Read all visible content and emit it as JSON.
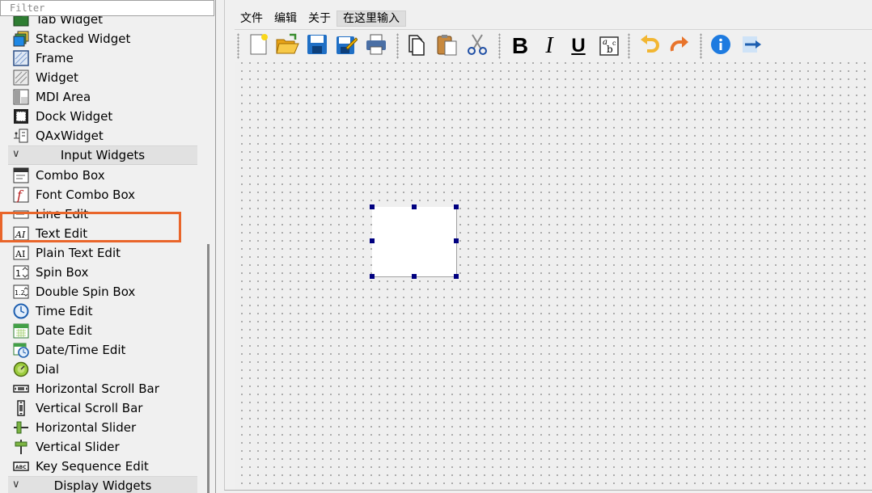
{
  "widget_box": {
    "filter_placeholder": "Filter",
    "section_top": [
      {
        "label": "Tab Widget",
        "icon": "tab-widget-icon"
      },
      {
        "label": "Stacked Widget",
        "icon": "stacked-widget-icon"
      },
      {
        "label": "Frame",
        "icon": "frame-icon"
      },
      {
        "label": "Widget",
        "icon": "widget-icon"
      },
      {
        "label": "MDI Area",
        "icon": "mdi-area-icon"
      },
      {
        "label": "Dock Widget",
        "icon": "dock-widget-icon"
      },
      {
        "label": "QAxWidget",
        "icon": "qaxwidget-icon"
      }
    ],
    "category_input": "Input Widgets",
    "input_widgets": [
      {
        "label": "Combo Box",
        "icon": "combo-box-icon"
      },
      {
        "label": "Font Combo Box",
        "icon": "font-combo-box-icon"
      },
      {
        "label": "Line Edit",
        "icon": "line-edit-icon"
      },
      {
        "label": "Text Edit",
        "icon": "text-edit-icon"
      },
      {
        "label": "Plain Text Edit",
        "icon": "plain-text-edit-icon"
      },
      {
        "label": "Spin Box",
        "icon": "spin-box-icon"
      },
      {
        "label": "Double Spin Box",
        "icon": "double-spin-box-icon"
      },
      {
        "label": "Time Edit",
        "icon": "time-edit-icon"
      },
      {
        "label": "Date Edit",
        "icon": "date-edit-icon"
      },
      {
        "label": "Date/Time Edit",
        "icon": "date-time-edit-icon"
      },
      {
        "label": "Dial",
        "icon": "dial-icon"
      },
      {
        "label": "Horizontal Scroll Bar",
        "icon": "horizontal-scroll-bar-icon"
      },
      {
        "label": "Vertical Scroll Bar",
        "icon": "vertical-scroll-bar-icon"
      },
      {
        "label": "Horizontal Slider",
        "icon": "horizontal-slider-icon"
      },
      {
        "label": "Vertical Slider",
        "icon": "vertical-slider-icon"
      },
      {
        "label": "Key Sequence Edit",
        "icon": "key-sequence-edit-icon"
      }
    ],
    "category_display": "Display Widgets",
    "highlighted_item": "Text Edit",
    "highlight_color": "#e9652a"
  },
  "form": {
    "menu": [
      "文件",
      "编辑",
      "关于",
      "在这里输入"
    ],
    "toolbar": {
      "bold": "B",
      "italic": "I",
      "underline": "U",
      "font_glyph_a": "a",
      "font_glyph_b": "b",
      "font_glyph_c": "c"
    },
    "selection_handle_color": "#000080"
  }
}
